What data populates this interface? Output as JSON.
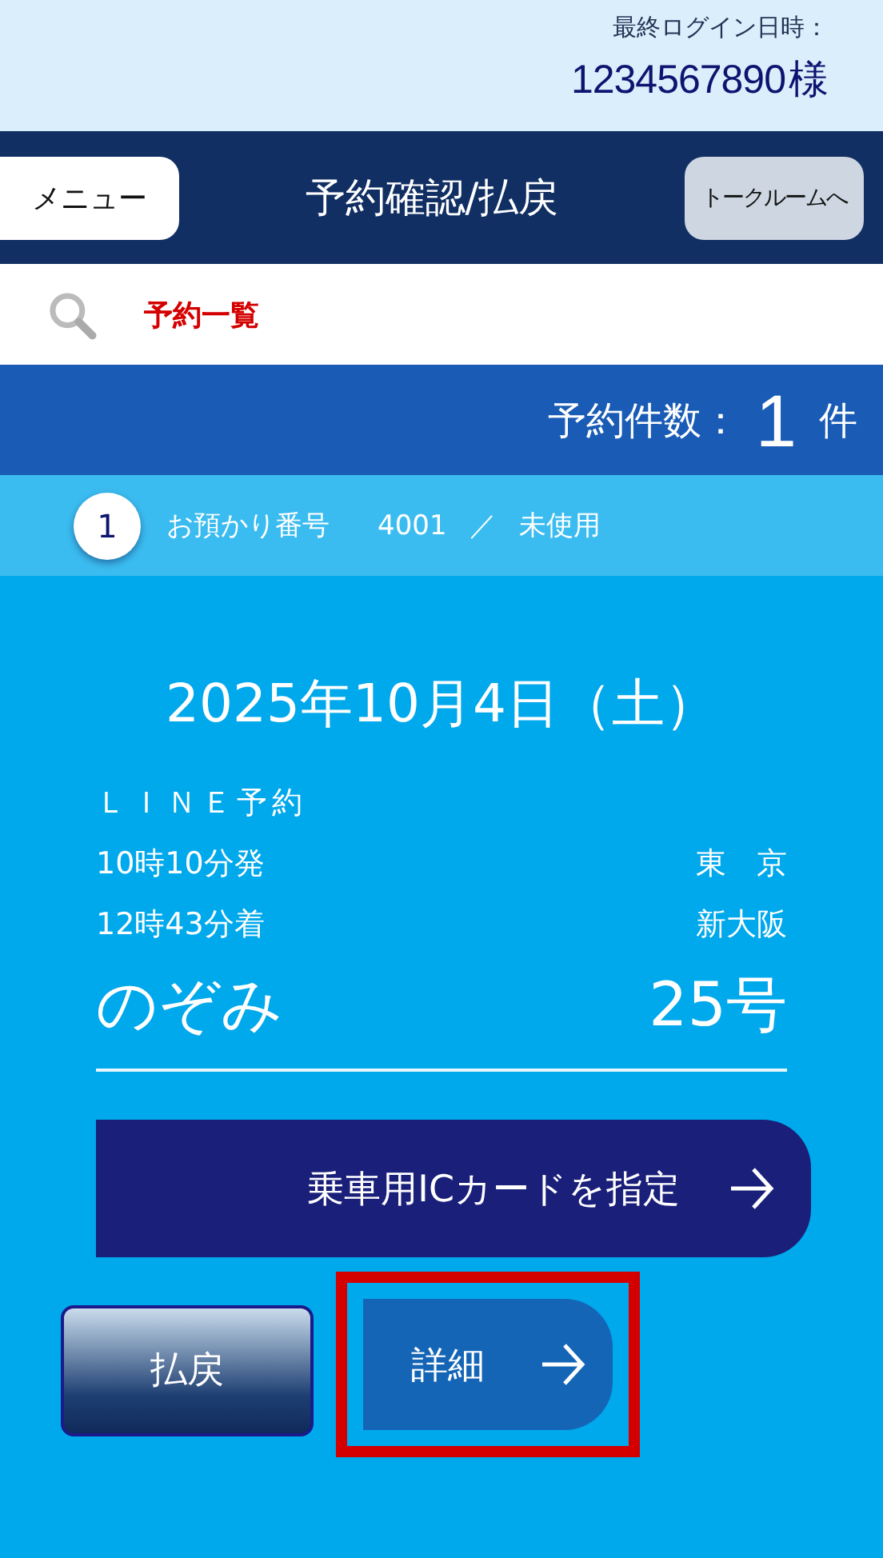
{
  "header": {
    "last_login_label": "最終ログイン日時：",
    "user_id": "1234567890",
    "honorific": "様"
  },
  "nav": {
    "menu_button": "メニュー",
    "title": "予約確認/払戻",
    "talk_button": "トークルームへ"
  },
  "search_row": {
    "label": "予約一覧"
  },
  "count_bar": {
    "label": "予約件数：",
    "count": "1",
    "unit": "件"
  },
  "reservations": [
    {
      "index": "1",
      "number_label": "お預かり番号",
      "number": "4001",
      "separator": "／",
      "status": "未使用",
      "date": "2025年10月4日（土）",
      "channel": "ＬＩＮＥ予約",
      "departure_time": "10時10分発",
      "departure_station": "東　京",
      "arrival_time": "12時43分着",
      "arrival_station": "新大阪",
      "train_name": "のぞみ",
      "train_number": "25号",
      "ic_button": "乗車用ICカードを指定",
      "refund_button": "払戻",
      "detail_button": "詳細",
      "detail_highlighted": true
    }
  ]
}
